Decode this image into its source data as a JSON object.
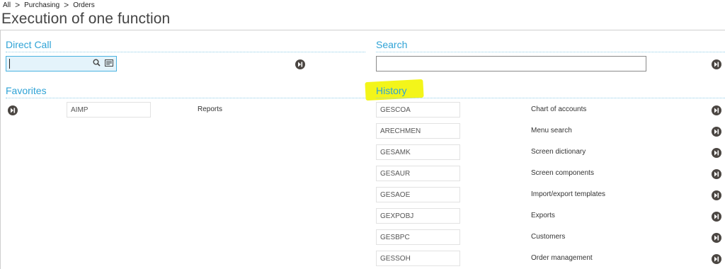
{
  "breadcrumb": {
    "items": [
      "All",
      "Purchasing",
      "Orders"
    ],
    "separator": ">"
  },
  "page_title": "Execution of one function",
  "direct_call": {
    "title": "Direct Call",
    "value": "",
    "placeholder": ""
  },
  "search": {
    "title": "Search",
    "value": "",
    "placeholder": ""
  },
  "favorites": {
    "title": "Favorites",
    "items": [
      {
        "code": "AIMP",
        "label": "Reports"
      }
    ]
  },
  "history": {
    "title": "History",
    "items": [
      {
        "code": "GESCOA",
        "label": "Chart of accounts"
      },
      {
        "code": "ARECHMEN",
        "label": "Menu search"
      },
      {
        "code": "GESAMK",
        "label": "Screen dictionary"
      },
      {
        "code": "GESAUR",
        "label": "Screen components"
      },
      {
        "code": "GESAOE",
        "label": "Import/export templates"
      },
      {
        "code": "GEXPOBJ",
        "label": "Exports"
      },
      {
        "code": "GESBPC",
        "label": "Customers"
      },
      {
        "code": "GESSOH",
        "label": "Order management"
      }
    ]
  },
  "colors": {
    "section_title": "#2fa3d6",
    "highlight": "#f3f51a",
    "button": "#4b4642",
    "input_focus_bg": "#e4f3fb"
  },
  "icons": {
    "go": "arrow-to-end-icon",
    "search": "magnifier-icon",
    "list": "list-card-icon"
  }
}
